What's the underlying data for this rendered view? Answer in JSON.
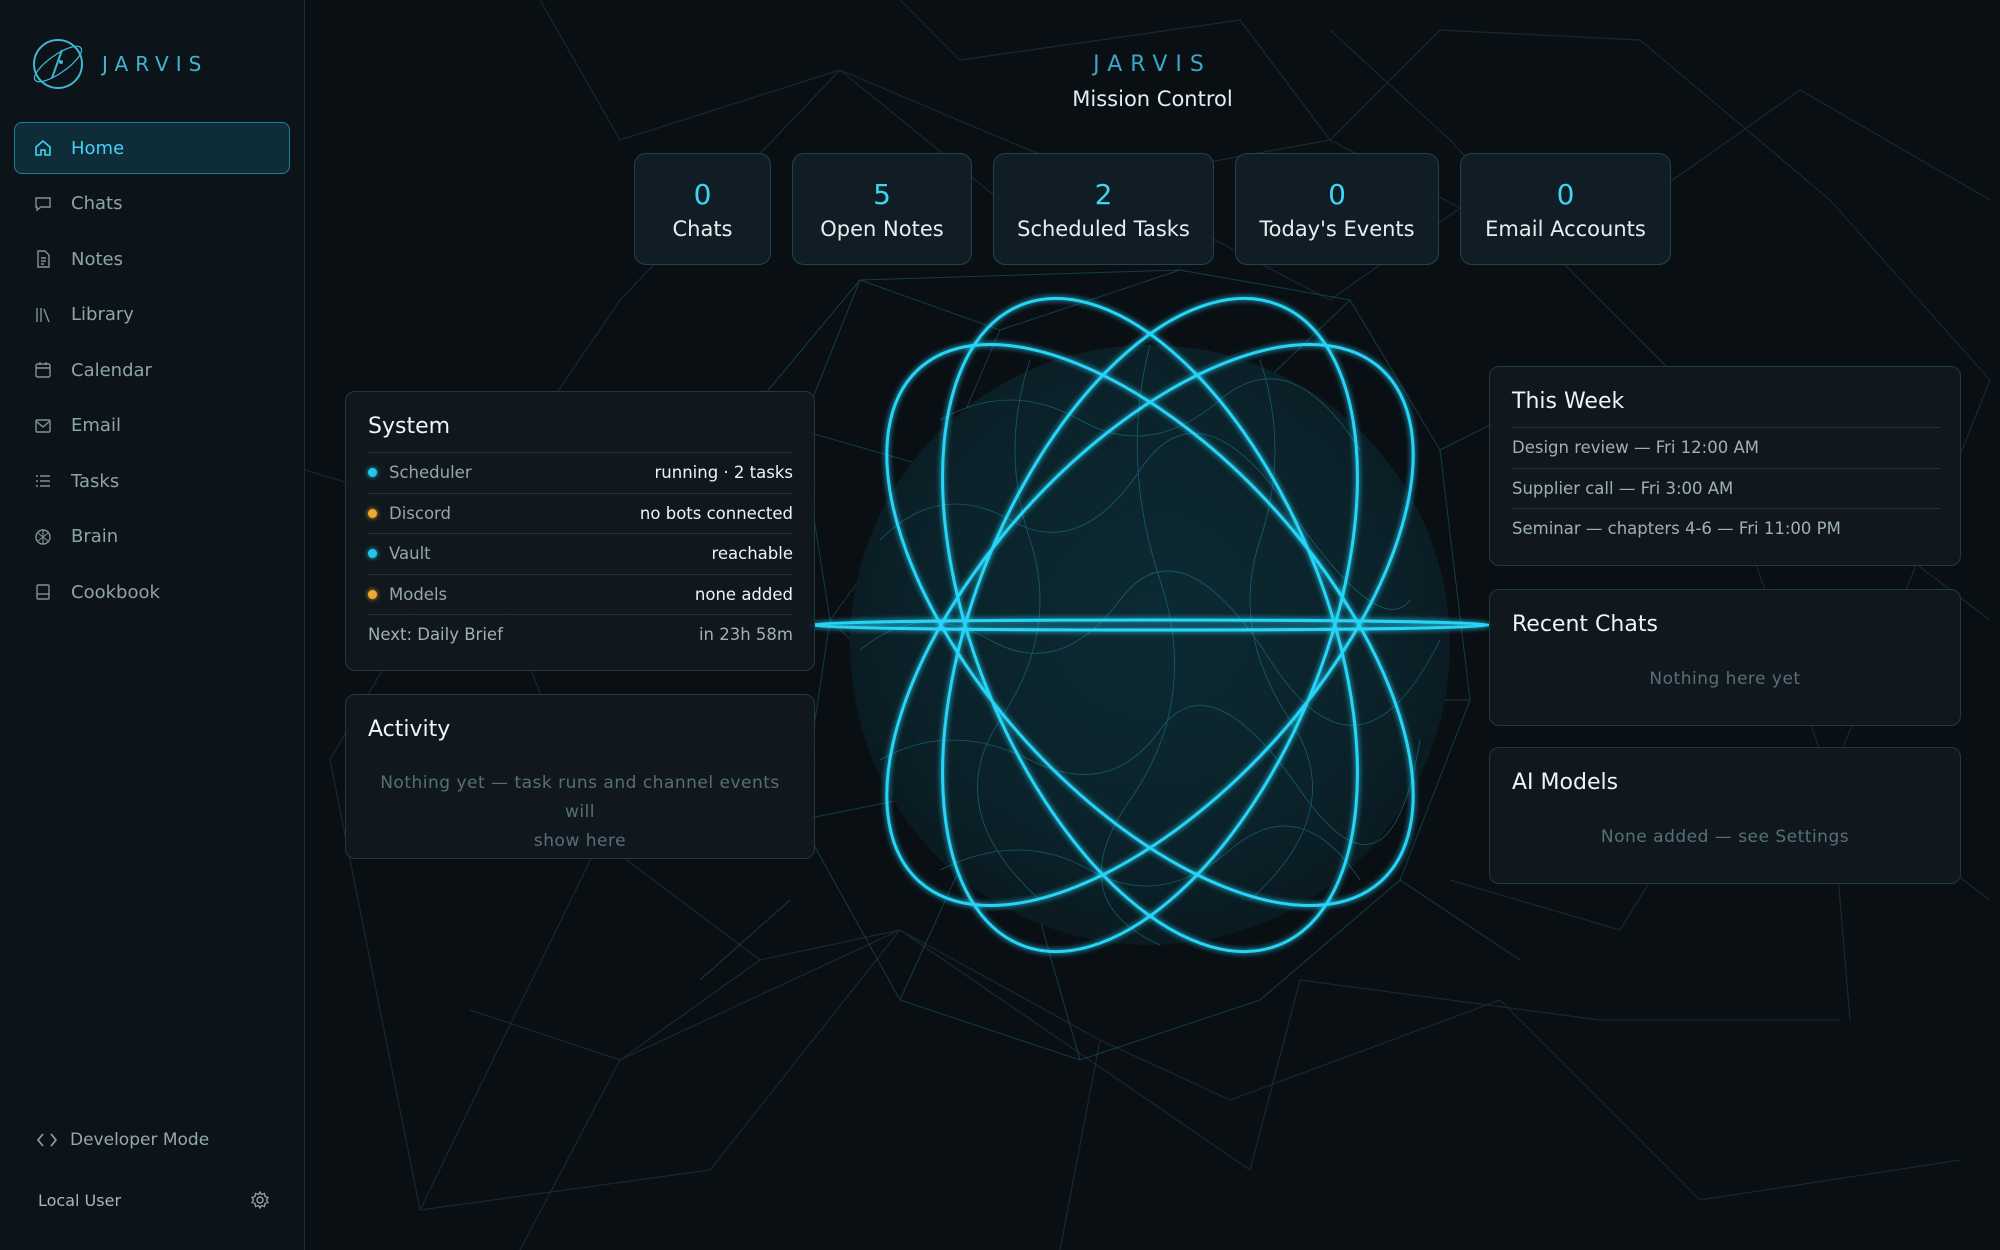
{
  "sidebar": {
    "brand": "JARVIS",
    "nav": [
      {
        "label": "Home",
        "icon": "home-icon",
        "active": true
      },
      {
        "label": "Chats",
        "icon": "chat-icon"
      },
      {
        "label": "Notes",
        "icon": "notes-icon"
      },
      {
        "label": "Library",
        "icon": "library-icon"
      },
      {
        "label": "Calendar",
        "icon": "calendar-icon"
      },
      {
        "label": "Email",
        "icon": "mail-icon"
      },
      {
        "label": "Tasks",
        "icon": "tasks-icon"
      },
      {
        "label": "Brain",
        "icon": "brain-icon"
      },
      {
        "label": "Cookbook",
        "icon": "cookbook-icon"
      }
    ],
    "developer_mode": "Developer Mode",
    "user": "Local User"
  },
  "header": {
    "brand": "JARVIS",
    "subtitle": "Mission Control"
  },
  "stats": [
    {
      "value": "0",
      "label": "Chats"
    },
    {
      "value": "5",
      "label": "Open Notes"
    },
    {
      "value": "2",
      "label": "Scheduled Tasks"
    },
    {
      "value": "0",
      "label": "Today's Events"
    },
    {
      "value": "0",
      "label": "Email Accounts"
    }
  ],
  "system": {
    "title": "System",
    "rows": [
      {
        "key": "Scheduler",
        "value": "running · 2 tasks",
        "status": "cyan"
      },
      {
        "key": "Discord",
        "value": "no bots connected",
        "status": "amber"
      },
      {
        "key": "Vault",
        "value": "reachable",
        "status": "cyan"
      },
      {
        "key": "Models",
        "value": "none added",
        "status": "amber"
      }
    ],
    "next_label": "Next: Daily Brief",
    "next_value": "in 23h 58m"
  },
  "activity": {
    "title": "Activity",
    "empty_line1": "Nothing yet — task runs and channel events will",
    "empty_line2": "show here"
  },
  "this_week": {
    "title": "This Week",
    "events": [
      "Design review — Fri 12:00 AM",
      "Supplier call — Fri 3:00 AM",
      "Seminar — chapters 4-6 — Fri 11:00 PM"
    ]
  },
  "recent_chats": {
    "title": "Recent Chats",
    "empty": "Nothing here yet"
  },
  "ai_models": {
    "title": "AI Models",
    "empty": "None added — see Settings"
  },
  "colors": {
    "accent": "#3fd4f5",
    "background": "#0a0f14",
    "status_ok": "#21c8ee",
    "status_warn": "#f0a92e"
  }
}
